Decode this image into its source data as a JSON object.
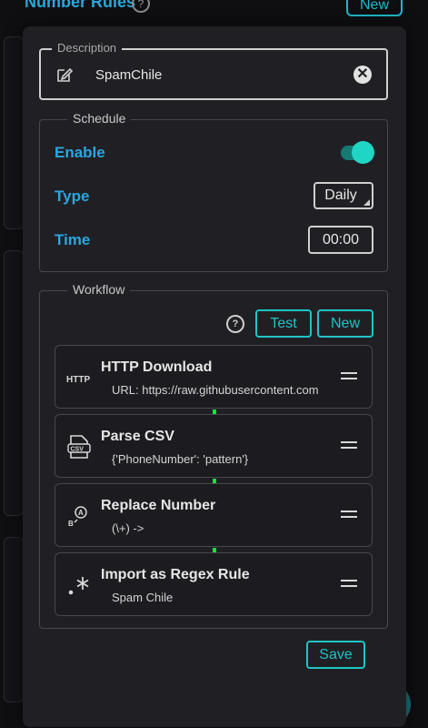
{
  "background": {
    "title": "Number Rules",
    "help_glyph": "?",
    "new_label": "New"
  },
  "description": {
    "legend": "Description",
    "value": "SpamChile",
    "clear_glyph": "✕"
  },
  "schedule": {
    "legend": "Schedule",
    "enable_label": "Enable",
    "enabled": true,
    "type_label": "Type",
    "type_value": "Daily",
    "time_label": "Time",
    "time_value": "00:00"
  },
  "workflow": {
    "legend": "Workflow",
    "help_glyph": "?",
    "test_label": "Test",
    "new_label": "New",
    "steps": [
      {
        "icon": "http-icon",
        "icon_text": "HTTP",
        "title": "HTTP Download",
        "subtitle": "URL: https://raw.githubusercontent.com"
      },
      {
        "icon": "csv-file-icon",
        "icon_text": "CSV",
        "title": "Parse CSV",
        "subtitle": "{'PhoneNumber': 'pattern'}"
      },
      {
        "icon": "replace-icon",
        "icon_text": "B A",
        "title": "Replace Number",
        "subtitle": "(\\+) ->"
      },
      {
        "icon": "regex-icon",
        "icon_text": ".*",
        "title": "Import as Regex Rule",
        "subtitle": "Spam Chile"
      }
    ]
  },
  "footer": {
    "save_label": "Save"
  },
  "colors": {
    "accent_blue": "#2aa6e0",
    "accent_teal": "#1fc4c6",
    "connector_green": "#19e13c",
    "dialog_bg": "#202024"
  }
}
